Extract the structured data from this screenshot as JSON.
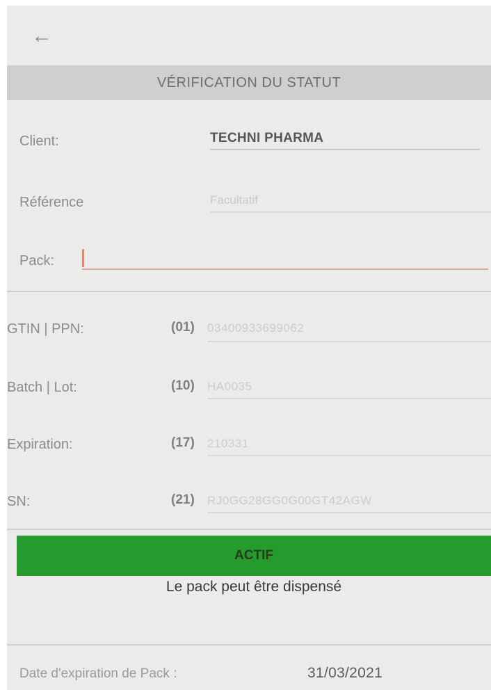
{
  "header": {
    "back_icon": "arrow-left-icon",
    "title": "VÉRIFICATION DU STATUT"
  },
  "form": {
    "client_label": "Client:",
    "client_value": "TECHNI PHARMA",
    "reference_label": "Référence",
    "reference_placeholder": "Facultatif",
    "pack_label": "Pack:",
    "pack_value": ""
  },
  "details": [
    {
      "label": "GTIN | PPN:",
      "code": "(01)",
      "value": "03400933699062"
    },
    {
      "label": "Batch | Lot:",
      "code": "(10)",
      "value": "HA0035"
    },
    {
      "label": "Expiration:",
      "code": "(17)",
      "value": "210331"
    },
    {
      "label": "SN:",
      "code": "(21)",
      "value": "RJ0GG28GG0G00GT42AGW"
    }
  ],
  "status": {
    "label": "ACTIF",
    "message": "Le pack peut être dispensé",
    "color": "#259a2d"
  },
  "footer": {
    "expiry_label": "Date d'expiration de Pack :",
    "expiry_value": "31/03/2021"
  }
}
